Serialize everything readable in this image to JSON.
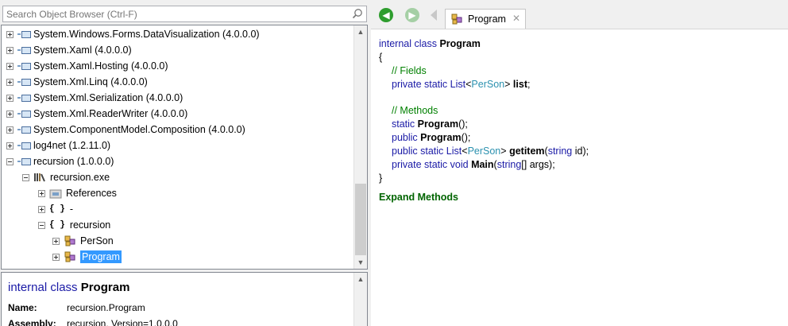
{
  "search": {
    "placeholder": "Search Object Browser (Ctrl-F)"
  },
  "tree": {
    "assemblies": [
      {
        "label": "System.Windows.Forms.DataVisualization (4.0.0.0)"
      },
      {
        "label": "System.Xaml (4.0.0.0)"
      },
      {
        "label": "System.Xaml.Hosting (4.0.0.0)"
      },
      {
        "label": "System.Xml.Linq (4.0.0.0)"
      },
      {
        "label": "System.Xml.Serialization (4.0.0.0)"
      },
      {
        "label": "System.Xml.ReaderWriter (4.0.0.0)"
      },
      {
        "label": "System.ComponentModel.Composition (4.0.0.0)"
      },
      {
        "label": "log4net (1.2.11.0)"
      },
      {
        "label": "recursion (1.0.0.0)"
      }
    ],
    "module": "recursion.exe",
    "references": "References",
    "ns_brace": "{ }",
    "ns_empty": "-",
    "ns_recursion": "recursion",
    "class_person": "PerSon",
    "class_program": "Program"
  },
  "detail": {
    "kw": "internal class",
    "name": "Program",
    "name_label": "Name:",
    "name_value": "recursion.Program",
    "assembly_label": "Assembly:",
    "assembly_value": "recursion, Version=1.0.0.0"
  },
  "tab": {
    "label": "Program",
    "close": "✕"
  },
  "nav": {
    "back": "◀",
    "forward": "▶"
  },
  "code": {
    "decl_kw": "internal class",
    "decl_name": "Program",
    "open": "{",
    "close": "}",
    "fields_comment": "// Fields",
    "field_kw": "private static",
    "field_type": "List",
    "field_generic_open": "<",
    "field_generic": "PerSon",
    "field_generic_close": ">",
    "field_name": "list",
    "field_end": ";",
    "methods_comment": "// Methods",
    "m1_kw": "static",
    "m1_name": "Program",
    "m1_rest": "();",
    "m2_kw": "public",
    "m2_name": "Program",
    "m2_rest": "();",
    "m3_kw": "public static",
    "m3_type": "List",
    "m3_generic": "PerSon",
    "m3_name": "getitem",
    "m3_param_kw": "string",
    "m3_param": " id);",
    "m4_kw": "private static void",
    "m4_name": "Main",
    "m4_param_kw": "string",
    "m4_param": "[] args);",
    "expand": "Expand Methods"
  },
  "colors": {
    "keyword": "#0000ff",
    "type": "#2b91af",
    "comment": "#008000",
    "selection": "#3399ff",
    "expand": "#006400"
  }
}
